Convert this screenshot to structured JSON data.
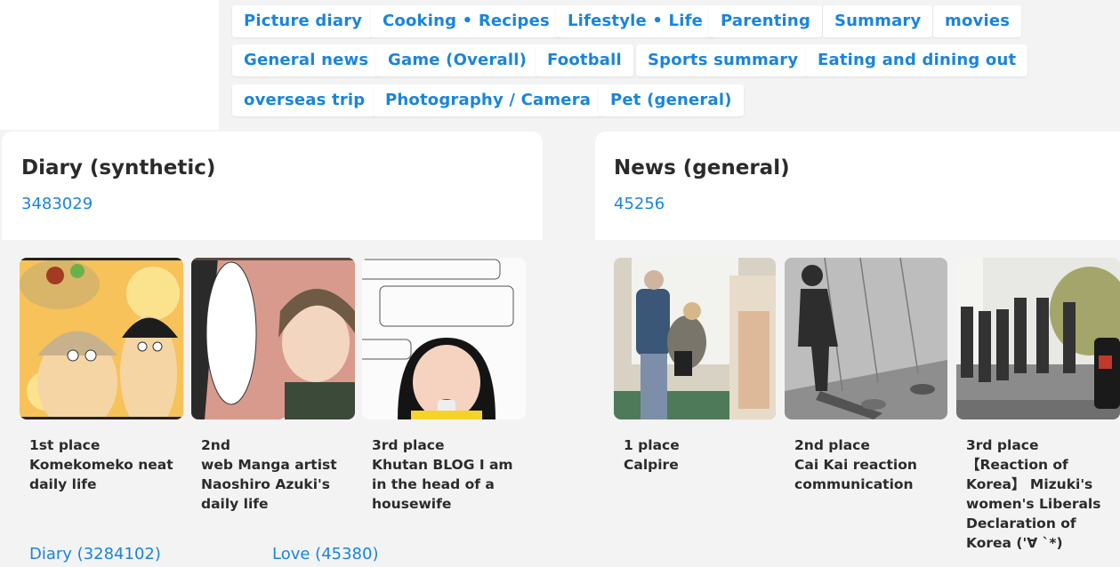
{
  "tags": {
    "row1": [
      "Picture diary",
      "Cooking • Recipes",
      "Lifestyle • Life",
      "Parenting",
      "Summary",
      "movies"
    ],
    "row2": [
      "General news",
      "Game (Overall)",
      "Football",
      "Sports summary",
      "Eating and dining out"
    ],
    "row3": [
      "overseas trip",
      "Photography / Camera",
      "Pet (general)"
    ]
  },
  "diary": {
    "title": "Diary (synthetic)",
    "count": "3483029",
    "rankings": [
      {
        "rank": "1st place",
        "title": "Komekomeko neat\ndaily life"
      },
      {
        "rank": "2nd",
        "title": "web Manga artist\nNaoshiro Azuki's\ndaily life"
      },
      {
        "rank": "3rd place",
        "title": "Khutan BLOG I am\nin the head of a\nhousewife"
      }
    ],
    "sublinks": [
      "Diary (3284102)",
      "Love (45380)"
    ]
  },
  "news": {
    "title": "News (general)",
    "count": "45256",
    "rankings": [
      {
        "rank": "1 place",
        "title": "Calpire"
      },
      {
        "rank": "2nd place",
        "title": "Cai Kai reaction\ncommunication"
      },
      {
        "rank": "3rd place",
        "title": "【Reaction of\nKorea】 Mizuki's\nwomen's Liberals\nDeclaration of\nKorea ('∀ `*)"
      }
    ]
  },
  "colors": {
    "accent": "#1a84dc",
    "text": "#2b2b2b",
    "panel": "#f3f3f3"
  }
}
